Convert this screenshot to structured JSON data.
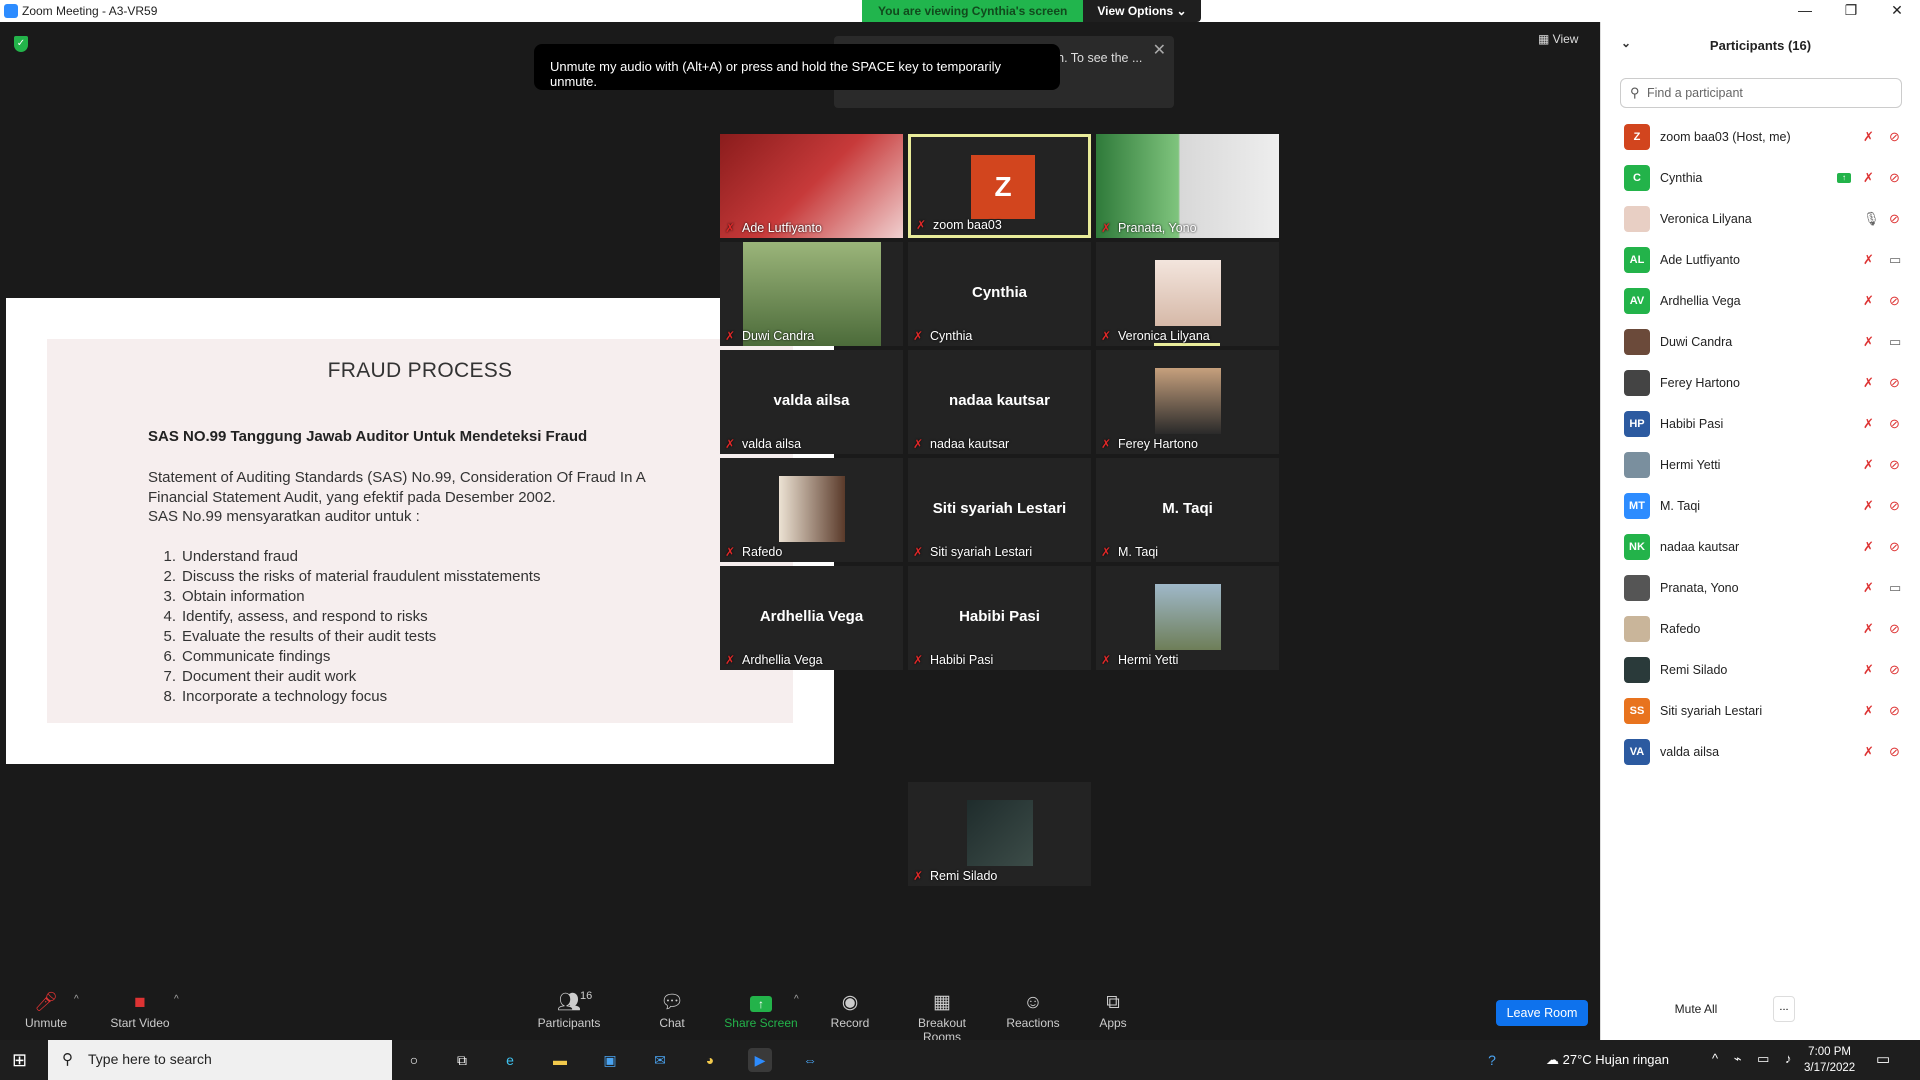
{
  "window": {
    "title": "Zoom Meeting - A3-VR59",
    "minimize": "—",
    "restore": "❐",
    "close": "✕"
  },
  "banner": {
    "viewing": "You are viewing Cynthia's screen",
    "view_options": "View Options ⌄"
  },
  "meeting": {
    "view_label": "View",
    "tooltip": "Unmute my audio with (Alt+A) or press and hold the SPACE key to temporarily unmute.",
    "fit_notice": "The shared content is fit to your screen. To see the ... menu."
  },
  "slide": {
    "title": "FRAUD PROCESS",
    "heading": "SAS NO.99 Tanggung Jawab Auditor Untuk Mendeteksi Fraud",
    "para1": "Statement of Auditing Standards (SAS) No.99, Consideration Of Fraud In A Financial Statement Audit, yang efektif pada Desember 2002.",
    "para2": "SAS No.99 mensyaratkan auditor untuk :",
    "items": [
      {
        "n": "1.",
        "text": "Understand fraud"
      },
      {
        "n": "2.",
        "text": "Discuss the risks of material fraudulent misstatements"
      },
      {
        "n": "3.",
        "text": "Obtain information"
      },
      {
        "n": "4.",
        "text": "Identify, assess, and respond to risks"
      },
      {
        "n": "5.",
        "text": "Evaluate the results of their audit tests"
      },
      {
        "n": "6.",
        "text": "Communicate findings"
      },
      {
        "n": "7.",
        "text": "Document their audit work"
      },
      {
        "n": "8.",
        "text": "Incorporate a technology focus"
      }
    ]
  },
  "gallery": {
    "tiles": [
      {
        "label": "Ade Lutfiyanto",
        "big": "",
        "kind": "news"
      },
      {
        "label": "zoom baa03",
        "big": "",
        "kind": "avatar",
        "avatar": "Z"
      },
      {
        "label": "Pranata, Yono",
        "big": "",
        "kind": "room"
      },
      {
        "label": "Duwi Candra",
        "big": "",
        "kind": "person-hijab"
      },
      {
        "label": "Cynthia",
        "big": "Cynthia",
        "kind": "name"
      },
      {
        "label": "Veronica Lilyana",
        "big": "",
        "kind": "person"
      },
      {
        "label": "valda ailsa",
        "big": "valda ailsa",
        "kind": "name"
      },
      {
        "label": "nadaa kautsar",
        "big": "nadaa kautsar",
        "kind": "name"
      },
      {
        "label": "Ferey Hartono",
        "big": "",
        "kind": "person-suit"
      },
      {
        "label": "Rafedo",
        "big": "",
        "kind": "dark-room"
      },
      {
        "label": "Siti syariah Lestari",
        "big": "Siti syariah Lestari",
        "kind": "name"
      },
      {
        "label": "M. Taqi",
        "big": "M. Taqi",
        "kind": "name"
      },
      {
        "label": "Ardhellia Vega",
        "big": "Ardhellia Vega",
        "kind": "name"
      },
      {
        "label": "Habibi Pasi",
        "big": "Habibi Pasi",
        "kind": "name"
      },
      {
        "label": "Hermi Yetti",
        "big": "",
        "kind": "landscape"
      },
      {
        "label": "Remi Silado",
        "big": "",
        "kind": "dark-art"
      }
    ]
  },
  "toolbar": {
    "unmute": "Unmute",
    "start_video": "Start Video",
    "participants": "Participants",
    "participants_count": "16",
    "chat": "Chat",
    "share_screen": "Share Screen",
    "record": "Record",
    "breakout": "Breakout Rooms",
    "reactions": "Reactions",
    "apps": "Apps",
    "leave": "Leave Room"
  },
  "panel": {
    "title": "Participants (16)",
    "search_placeholder": "Find a participant",
    "mute_all": "Mute All",
    "more": "...",
    "participants": [
      {
        "initials": "Z",
        "name": "zoom baa03 (Host, me)",
        "color": "#d2451e",
        "cam": "off",
        "mic": "off"
      },
      {
        "initials": "C",
        "name": "Cynthia",
        "color": "#23b34a",
        "cam": "off",
        "mic": "off",
        "sharing": true
      },
      {
        "initials": "",
        "name": "Veronica Lilyana",
        "color": "#e8cfc4",
        "cam": "off",
        "mic": "on"
      },
      {
        "initials": "AL",
        "name": "Ade Lutfiyanto",
        "color": "#23b34a",
        "cam": "on",
        "mic": "off"
      },
      {
        "initials": "AV",
        "name": "Ardhellia Vega",
        "color": "#23b34a",
        "cam": "off",
        "mic": "off"
      },
      {
        "initials": "",
        "name": "Duwi Candra",
        "color": "#6b4a3a",
        "cam": "on",
        "mic": "off"
      },
      {
        "initials": "",
        "name": "Ferey Hartono",
        "color": "#444",
        "cam": "off",
        "mic": "off"
      },
      {
        "initials": "HP",
        "name": "Habibi Pasi",
        "color": "#2c5aa0",
        "cam": "off",
        "mic": "off"
      },
      {
        "initials": "",
        "name": "Hermi Yetti",
        "color": "#7a8f9e",
        "cam": "off",
        "mic": "off"
      },
      {
        "initials": "MT",
        "name": "M. Taqi",
        "color": "#2d8cff",
        "cam": "off",
        "mic": "off"
      },
      {
        "initials": "NK",
        "name": "nadaa kautsar",
        "color": "#23b34a",
        "cam": "off",
        "mic": "off"
      },
      {
        "initials": "",
        "name": "Pranata, Yono",
        "color": "#555",
        "cam": "on",
        "mic": "off"
      },
      {
        "initials": "",
        "name": "Rafedo",
        "color": "#c9b59a",
        "cam": "off",
        "mic": "off"
      },
      {
        "initials": "",
        "name": "Remi Silado",
        "color": "#2a3a3a",
        "cam": "off",
        "mic": "off"
      },
      {
        "initials": "SS",
        "name": "Siti syariah Lestari",
        "color": "#e8731e",
        "cam": "off",
        "mic": "off"
      },
      {
        "initials": "VA",
        "name": "valda ailsa",
        "color": "#2c5aa0",
        "cam": "off",
        "mic": "off"
      }
    ]
  },
  "taskbar": {
    "search_placeholder": "Type here to search",
    "weather": "27°C  Hujan ringan",
    "time": "7:00 PM",
    "date": "3/17/2022"
  }
}
